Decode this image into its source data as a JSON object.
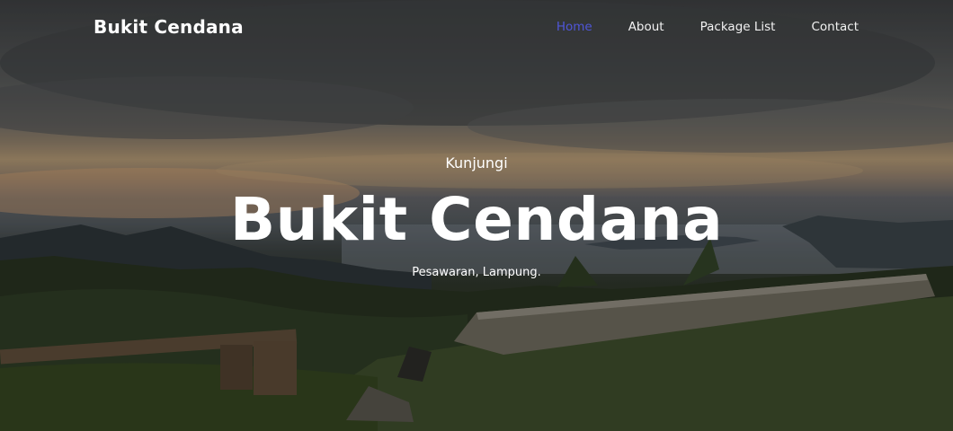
{
  "nav": {
    "brand": "Bukit Cendana",
    "links": [
      {
        "label": "Home",
        "active": true
      },
      {
        "label": "About",
        "active": false
      },
      {
        "label": "Package List",
        "active": false
      },
      {
        "label": "Contact",
        "active": false
      }
    ]
  },
  "hero": {
    "kicker": "Kunjungi",
    "title": "Bukit Cendana",
    "subtitle": "Pesawaran, Lampung."
  },
  "colors": {
    "active_link": "#4f56d8",
    "text": "#ffffff"
  }
}
